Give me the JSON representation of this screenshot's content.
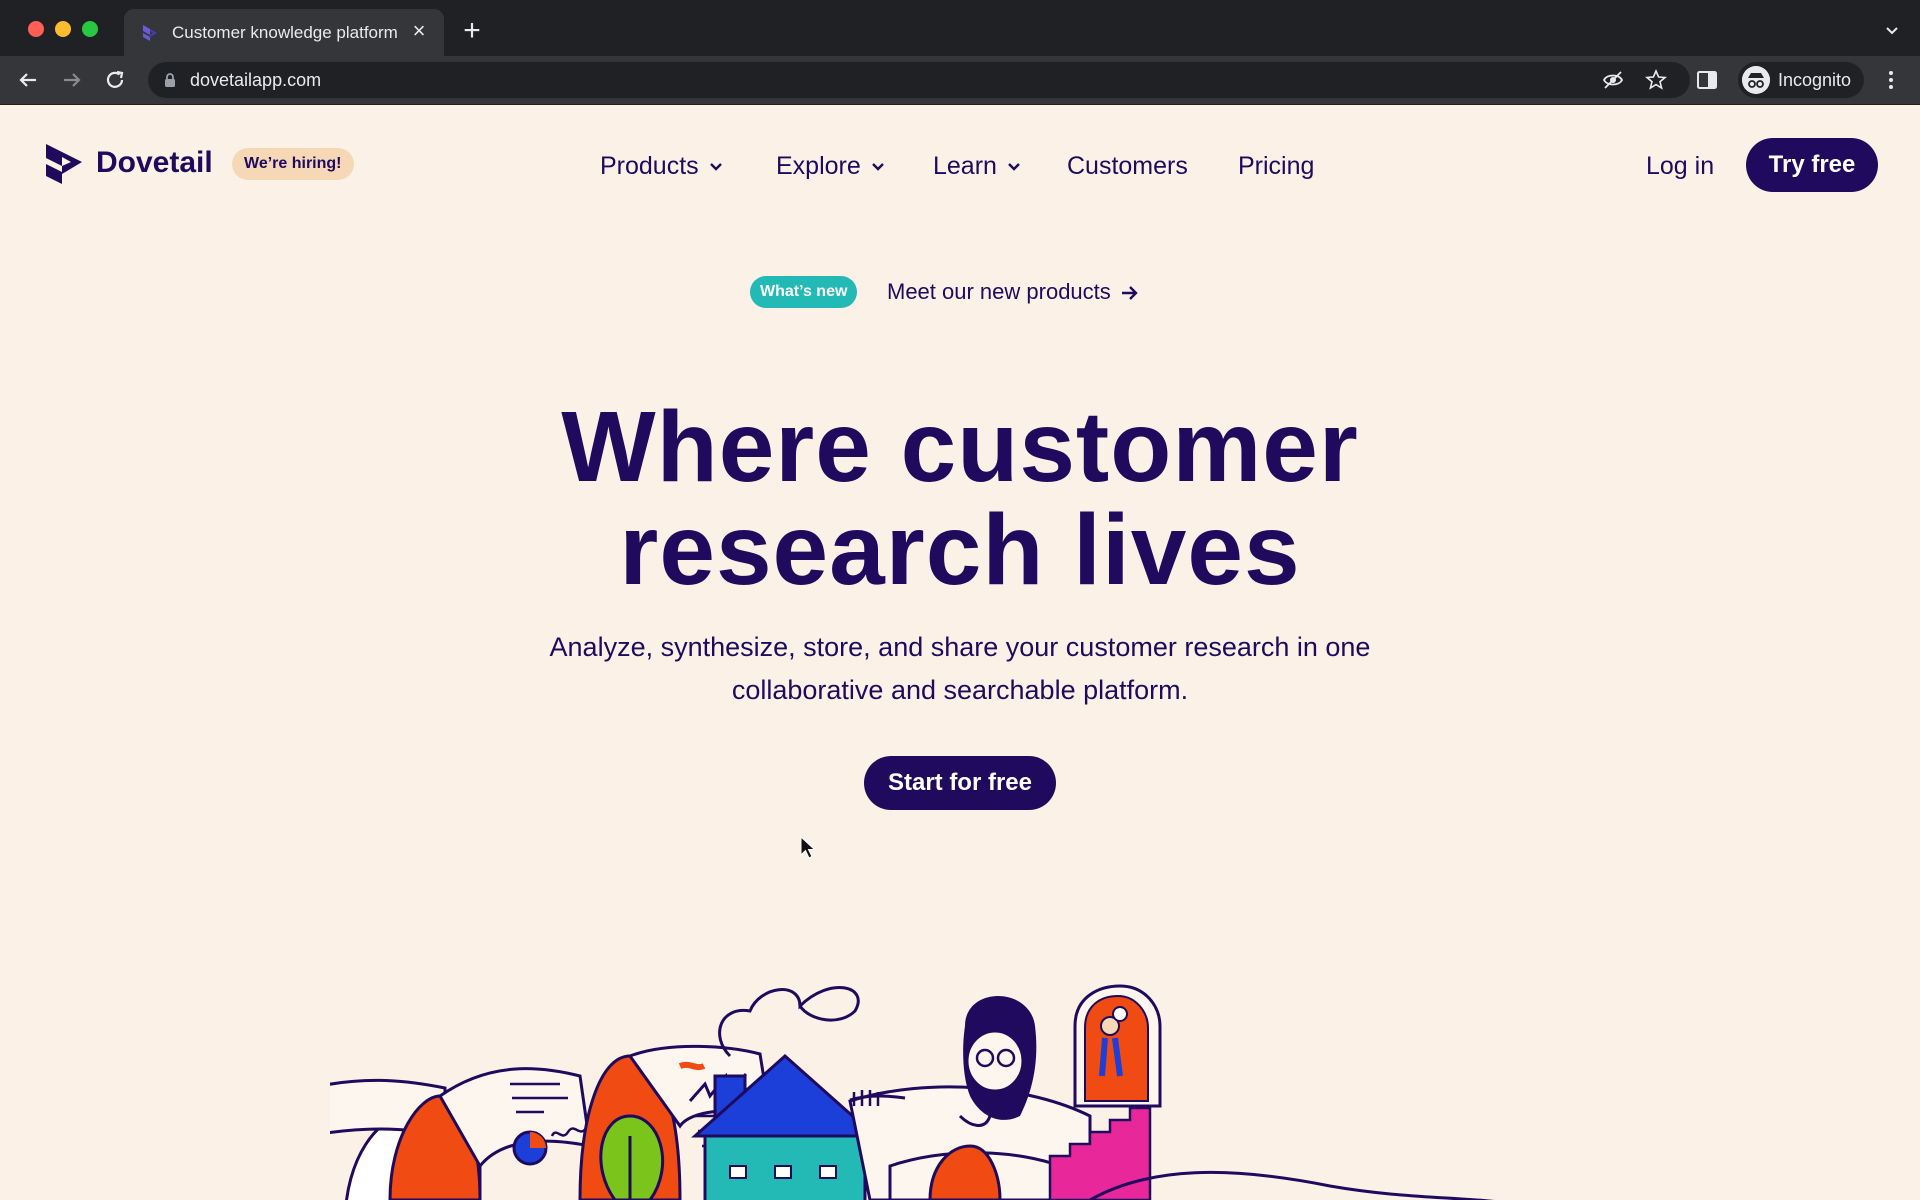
{
  "browser": {
    "tab_title": "Customer knowledge platform",
    "tab_close": "×",
    "new_tab": "+",
    "url": "dovetailapp.com",
    "profile_label": "Incognito"
  },
  "site": {
    "brand_name": "Dovetail",
    "hiring_badge": "We’re hiring!",
    "nav": [
      {
        "label": "Products",
        "has_dropdown": true
      },
      {
        "label": "Explore",
        "has_dropdown": true
      },
      {
        "label": "Learn",
        "has_dropdown": true
      },
      {
        "label": "Customers",
        "has_dropdown": false
      },
      {
        "label": "Pricing",
        "has_dropdown": false
      }
    ],
    "login_label": "Log in",
    "try_free_label": "Try free"
  },
  "announcement": {
    "badge": "What’s new",
    "link_label": "Meet our new products"
  },
  "hero": {
    "title_line1": "Where customer",
    "title_line2": "research lives",
    "subtitle_line1": "Analyze, synthesize, store, and share your customer research in one",
    "subtitle_line2": "collaborative and searchable platform.",
    "cta_label": "Start for free"
  },
  "colors": {
    "brand_navy": "#1f0a5e",
    "page_background": "#fcf1e6",
    "badge_teal": "#23b9b5",
    "hiring_badge_bg": "#f6d8b7"
  }
}
